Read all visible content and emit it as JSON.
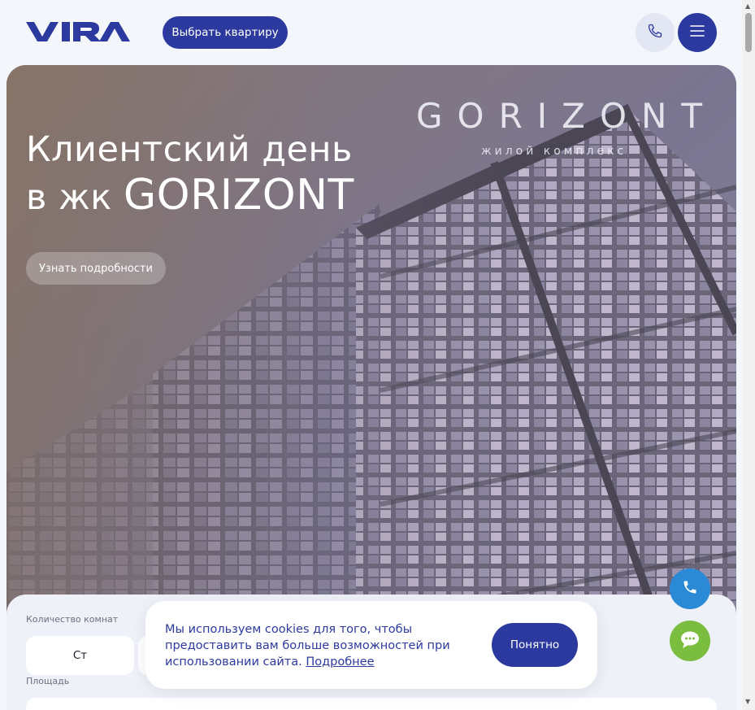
{
  "header": {
    "logo_text": "VIRA",
    "pick_apartment_label": "Выбрать квартиру",
    "icons": {
      "phone": "phone-icon",
      "menu": "menu-icon"
    }
  },
  "hero": {
    "title_line1": "Клиентский день",
    "title_line2_prefix": "в жк ",
    "title_line2_brand": "GORIZONT",
    "details_button": "Узнать подробности",
    "brand_wordmark": "GORIZONT",
    "brand_subtitle": "жилой комплекс"
  },
  "filter": {
    "rooms_label": "Количество комнат",
    "rooms": [
      "Ст"
    ],
    "area_label": "Площадь"
  },
  "cookie": {
    "text": "Мы используем cookies для того, чтобы предоставить вам больше возможностей при использовании сайта. ",
    "link": "Подробнее",
    "accept_button": "Понятно"
  },
  "floating": {
    "call_icon": "phone-icon",
    "chat_icon": "chat-icon"
  },
  "colors": {
    "brand_blue": "#2c3a9f",
    "call_blue": "#2b8ad6",
    "chat_green": "#7bbd3f"
  }
}
